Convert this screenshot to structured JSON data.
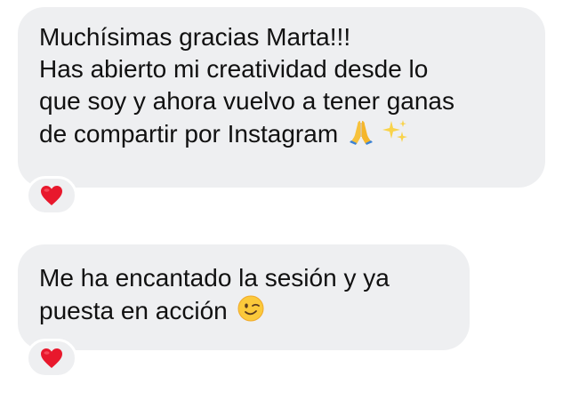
{
  "messages": [
    {
      "lines": [
        "Muchísimas gracias Marta!!!",
        "Has abierto mi creatividad desde lo",
        "que soy y ahora vuelvo a tener ganas",
        "de compartir por Instagram"
      ],
      "trailing_emojis": [
        "folded-hands-icon",
        "sparkles-icon"
      ],
      "reaction": "red-heart-icon"
    },
    {
      "lines": [
        "Me ha encantado la sesión y ya",
        "puesta en acción"
      ],
      "trailing_emojis": [
        "winking-face-icon"
      ],
      "reaction": "red-heart-icon"
    }
  ],
  "colors": {
    "bubble_background": "#eeeff1",
    "text": "#111111",
    "heart": "#e8182c"
  }
}
